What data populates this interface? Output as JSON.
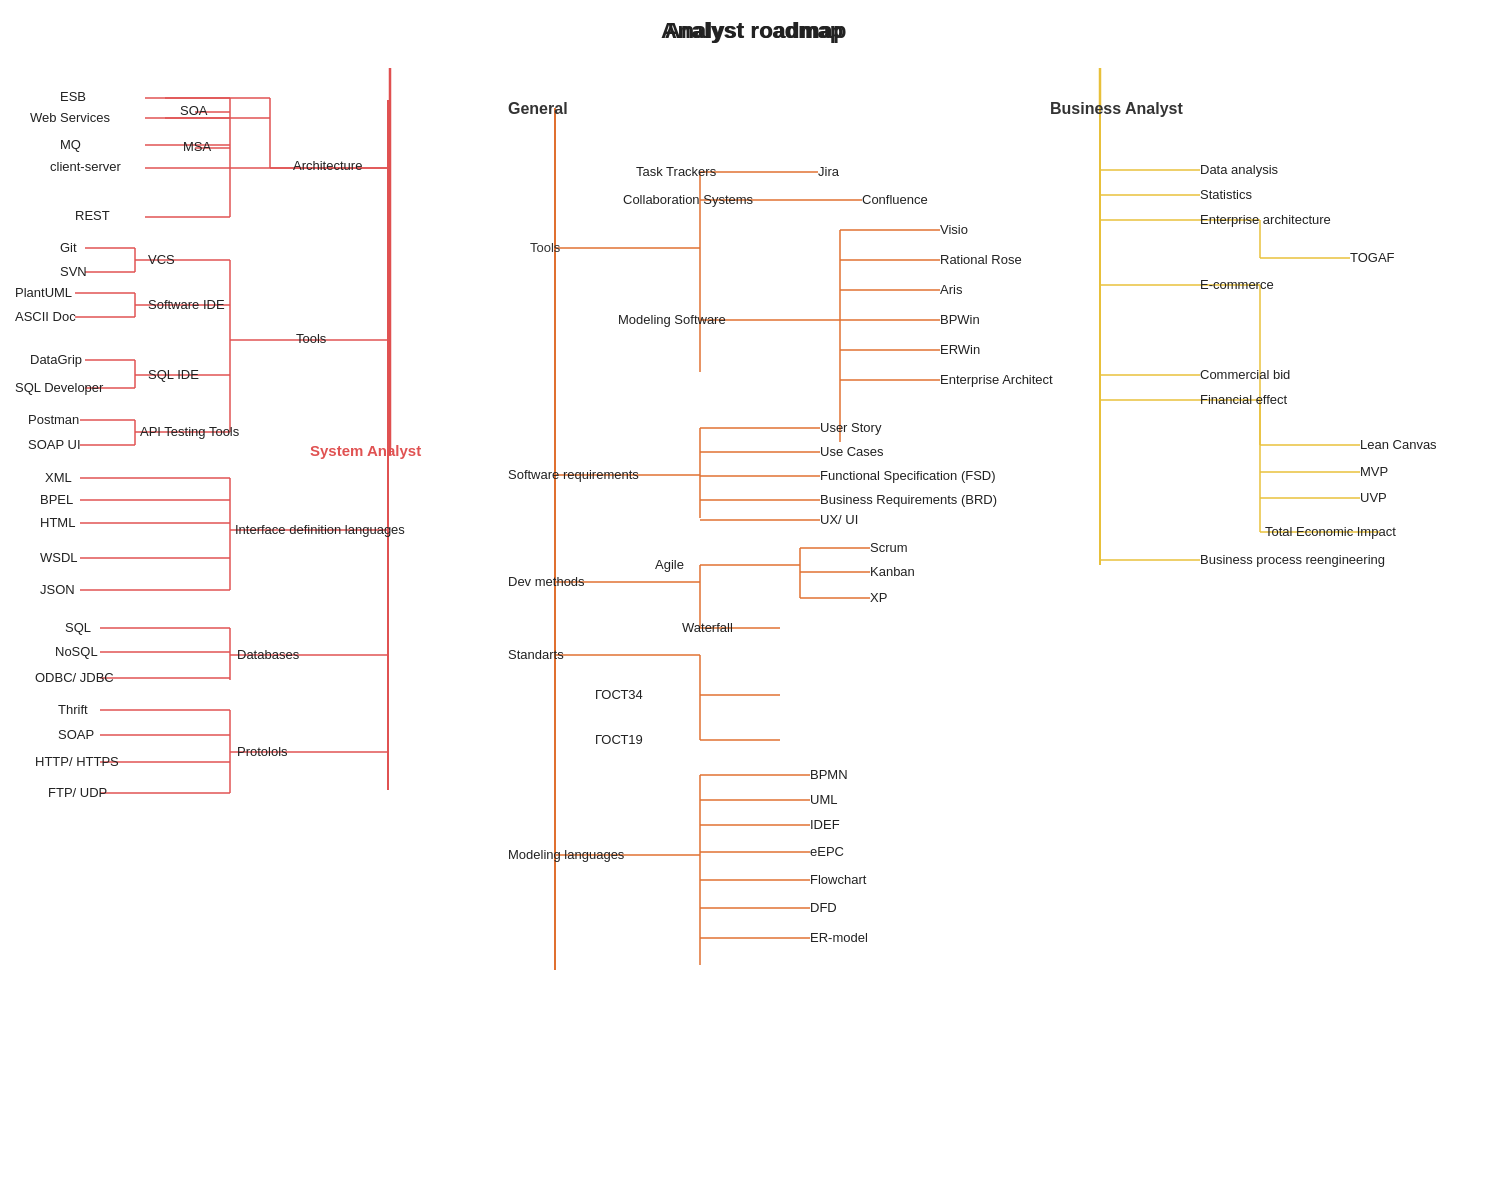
{
  "title": "Analyst roadmap",
  "colors": {
    "red": "#e05252",
    "orange": "#e8843a",
    "yellow": "#e8c03a",
    "redDark": "#cc3333",
    "orangeMid": "#e07030"
  },
  "systemAnalyst": {
    "label": "System Analyst",
    "architecture": {
      "label": "Architecture",
      "items": [
        "ESB",
        "Web Services",
        "MQ",
        "MSA",
        "SOA",
        "client-server",
        "REST"
      ]
    },
    "tools": {
      "label": "Tools",
      "softwareIDE": {
        "label": "Software IDE",
        "items": [
          "PlantUML",
          "ASCII Doc"
        ]
      },
      "sqlIDE": {
        "label": "SQL IDE",
        "items": [
          "DataGrip",
          "SQL Developer"
        ]
      },
      "apiTesting": {
        "label": "API Testing Tools",
        "items": [
          "Postman",
          "SOAP UI"
        ]
      },
      "vcs": {
        "label": "VCS",
        "items": [
          "Git",
          "SVN"
        ]
      }
    },
    "interfaceDef": {
      "label": "Interface definition languages",
      "items": [
        "XML",
        "BPEL",
        "HTML",
        "WSDL",
        "JSON"
      ]
    },
    "databases": {
      "label": "Databases",
      "items": [
        "SQL",
        "NoSQL",
        "ODBC/ JDBC"
      ]
    },
    "protocols": {
      "label": "Protolols",
      "items": [
        "Thrift",
        "SOAP",
        "HTTP/ HTTPS",
        "FTP/ UDP"
      ]
    }
  },
  "general": {
    "label": "General",
    "tools": {
      "label": "Tools",
      "taskTrackers": {
        "label": "Task Trackers",
        "item": "Jira"
      },
      "collabSystems": {
        "label": "Collaboration Systems",
        "item": "Confluence"
      },
      "modelingSoftware": {
        "label": "Modeling Software",
        "items": [
          "Visio",
          "Rational Rose",
          "Aris",
          "BPWin",
          "ERWin",
          "Enterprise Architect"
        ]
      }
    },
    "softwareReq": {
      "label": "Software requirements",
      "items": [
        "User Story",
        "Use Cases",
        "Functional Specification (FSD)",
        "Business Requirements (BRD)",
        "UX/ UI"
      ]
    },
    "devMethods": {
      "label": "Dev methods",
      "agile": {
        "label": "Agile",
        "items": [
          "Scrum",
          "Kanban",
          "XP"
        ]
      },
      "waterfall": "Waterfall"
    },
    "standarts": {
      "label": "Standarts",
      "items": [
        "ГОСТ34",
        "ГОСТ19"
      ]
    },
    "modelingLangs": {
      "label": "Modeling languages",
      "items": [
        "BPMN",
        "UML",
        "IDEF",
        "eEPC",
        "Flowchart",
        "DFD",
        "ER-model"
      ]
    }
  },
  "businessAnalyst": {
    "label": "Business Analyst",
    "items": [
      "Data analysis",
      "Statistics",
      "Enterprise architecture",
      "TOGAF",
      "E-commerce",
      "Lean Canvas",
      "MVP",
      "UVP",
      "Commercial bid",
      "Financial effect",
      "Total Economic Impact",
      "Business process reengineering"
    ]
  }
}
